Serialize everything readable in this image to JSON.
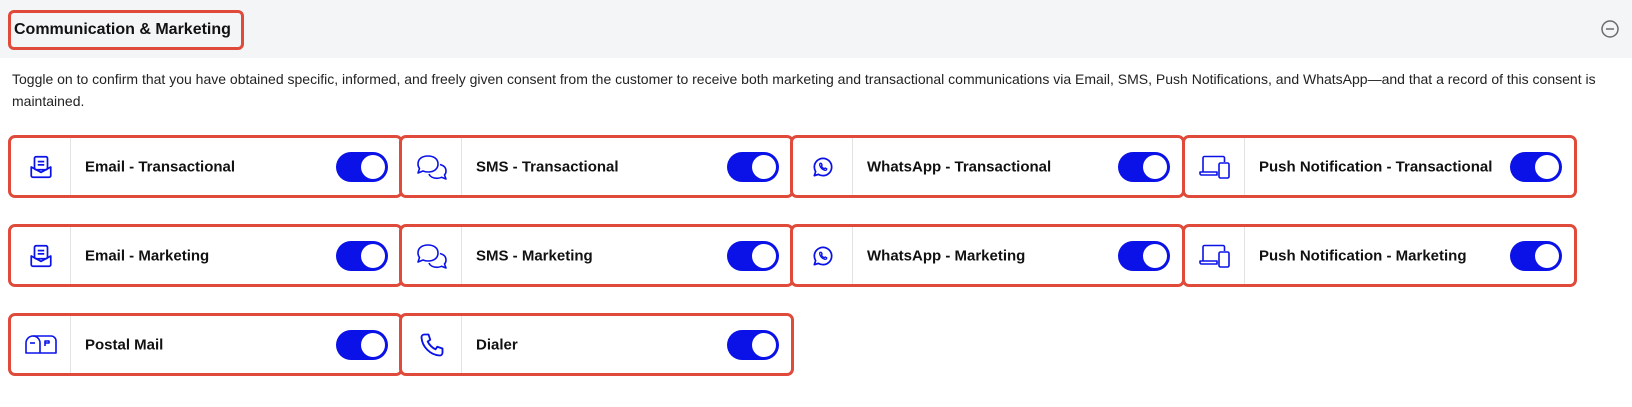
{
  "section": {
    "title": "Communication & Marketing",
    "description": "Toggle on to confirm that you have obtained specific, informed, and freely given consent from the customer to receive both marketing and transactional communications via Email, SMS, Push Notifications, and WhatsApp—and that a record of this consent is maintained."
  },
  "colors": {
    "accent": "#0a12e8",
    "highlight_border": "#e04a3b",
    "header_bg": "#f4f5f7"
  },
  "channels": [
    {
      "label": "Email - Transactional",
      "icon": "email-inbox-icon",
      "enabled": true
    },
    {
      "label": "SMS - Transactional",
      "icon": "chat-bubbles-icon",
      "enabled": true
    },
    {
      "label": "WhatsApp - Transactional",
      "icon": "whatsapp-icon",
      "enabled": true
    },
    {
      "label": "Push Notification - Transactional",
      "icon": "devices-icon",
      "enabled": true
    },
    {
      "label": "Email - Marketing",
      "icon": "email-inbox-icon",
      "enabled": true
    },
    {
      "label": "SMS - Marketing",
      "icon": "chat-bubbles-icon",
      "enabled": true
    },
    {
      "label": "WhatsApp - Marketing",
      "icon": "whatsapp-icon",
      "enabled": true
    },
    {
      "label": "Push Notification - Marketing",
      "icon": "devices-icon",
      "enabled": true
    },
    {
      "label": "Postal Mail",
      "icon": "mailbox-icon",
      "enabled": true
    },
    {
      "label": "Dialer",
      "icon": "phone-icon",
      "enabled": true
    }
  ]
}
